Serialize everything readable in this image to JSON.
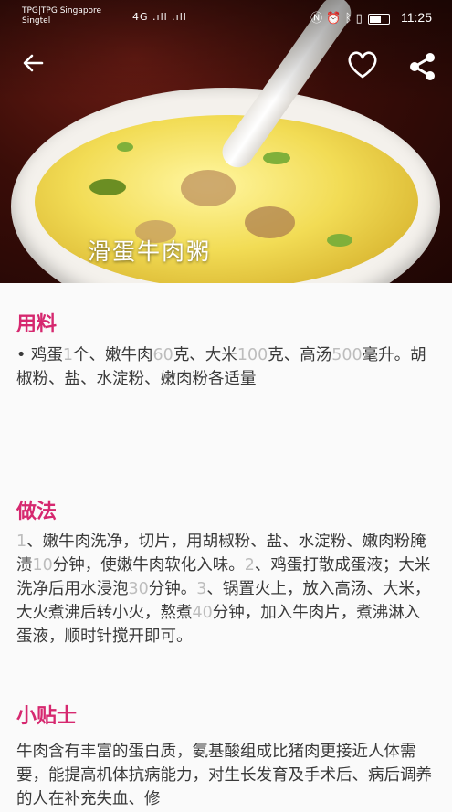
{
  "status_bar": {
    "carrier_line1": "TPG|TPG Singapore",
    "carrier_line2": "Singtel",
    "signal": "4G .ıll .ıll",
    "icons": [
      "nfc-icon",
      "alarm-icon",
      "bluetooth-icon",
      "vibrate-icon",
      "battery-icon"
    ],
    "time": "11:25"
  },
  "header": {
    "back_icon": "back-arrow-icon",
    "favorite_icon": "heart-outline-icon",
    "share_icon": "share-icon",
    "dish_title": "滑蛋牛肉粥"
  },
  "ingredients": {
    "title": "用料",
    "segments": [
      {
        "t": "• 鸡蛋",
        "n": false
      },
      {
        "t": "1",
        "n": true
      },
      {
        "t": "个、嫩牛肉",
        "n": false
      },
      {
        "t": "60",
        "n": true
      },
      {
        "t": "克、大米",
        "n": false
      },
      {
        "t": "100",
        "n": true
      },
      {
        "t": "克、高汤",
        "n": false
      },
      {
        "t": "500",
        "n": true
      },
      {
        "t": "毫升。胡椒粉、盐、水淀粉、嫩肉粉各适量",
        "n": false
      }
    ]
  },
  "method": {
    "title": "做法",
    "segments": [
      {
        "t": "1",
        "n": true
      },
      {
        "t": "、嫩牛肉洗净，切片，用胡椒粉、盐、水淀粉、嫩肉粉腌渍",
        "n": false
      },
      {
        "t": "10",
        "n": true
      },
      {
        "t": "分钟，使嫩牛肉软化入味。",
        "n": false
      },
      {
        "t": "2",
        "n": true
      },
      {
        "t": "、鸡蛋打散成蛋液；大米洗净后用水浸泡",
        "n": false
      },
      {
        "t": "30",
        "n": true
      },
      {
        "t": "分钟。",
        "n": false
      },
      {
        "t": "3",
        "n": true
      },
      {
        "t": "、锅置火上，放入高汤、大米，大火煮沸后转小火，熬煮",
        "n": false
      },
      {
        "t": "40",
        "n": true
      },
      {
        "t": "分钟，加入牛肉片，煮沸淋入蛋液，顺时针搅开即可。",
        "n": false
      }
    ]
  },
  "tips": {
    "title": "小贴士",
    "text": " 牛肉含有丰富的蛋白质，氨基酸组成比猪肉更接近人体需要，能提高机体抗病能力，对生长发育及手术后、病后调养的人在补充失血、修"
  },
  "colors": {
    "accent": "#d6286f",
    "number": "#bdbdbd",
    "body_text": "#3a3a3a"
  }
}
